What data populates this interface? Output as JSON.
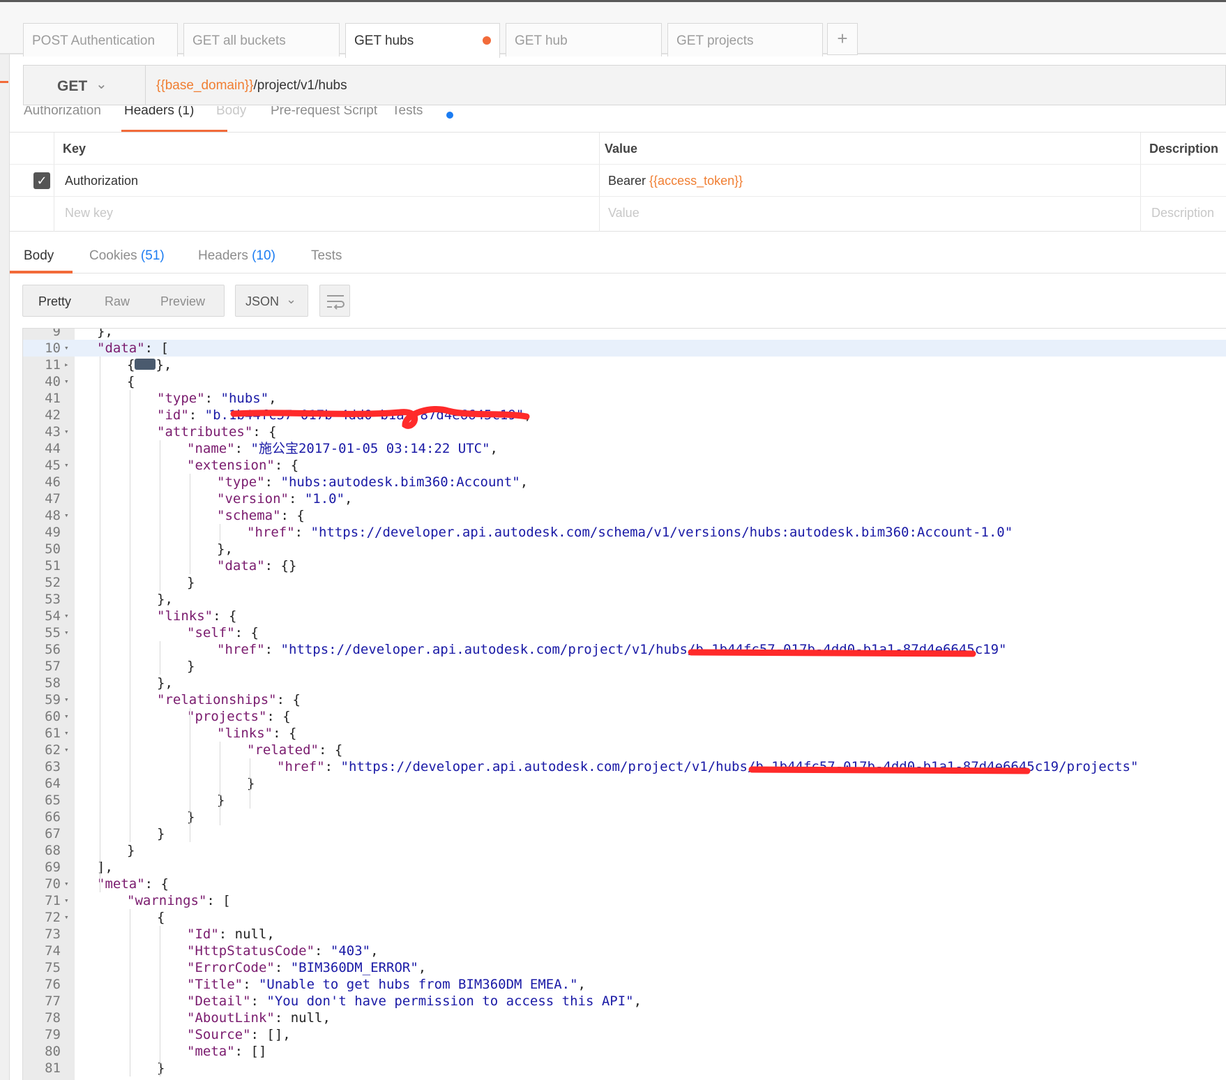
{
  "tabs": [
    {
      "label": "POST Authentication"
    },
    {
      "label": "GET all buckets"
    },
    {
      "label": "GET hubs"
    },
    {
      "label": "GET hub"
    },
    {
      "label": "GET projects"
    }
  ],
  "add_tab": "+",
  "request": {
    "method": "GET",
    "url_var": "{{base_domain}}",
    "url_path": "/project/v1/hubs"
  },
  "request_tabs": [
    "Authorization",
    "Headers (1)",
    "Body",
    "Pre-request Script",
    "Tests"
  ],
  "headers_table": {
    "columns": [
      "Key",
      "Value",
      "Description"
    ],
    "row": {
      "key": "Authorization",
      "value_prefix": "Bearer ",
      "value_var": "{{access_token}}"
    },
    "placeholder": {
      "key": "New key",
      "value": "Value",
      "description": "Description"
    }
  },
  "response_tabs": [
    {
      "label": "Body",
      "count": ""
    },
    {
      "label": "Cookies ",
      "count": "(51)"
    },
    {
      "label": "Headers ",
      "count": "(10)"
    },
    {
      "label": "Tests",
      "count": ""
    }
  ],
  "view_modes": [
    "Pretty",
    "Raw",
    "Preview"
  ],
  "format": "JSON",
  "icons": {
    "dropdown": "chevron-down-icon",
    "wrap": "wrap-lines-icon",
    "check": "check-icon"
  },
  "colors": {
    "accent": "#f26b3a",
    "variable": "#f07e32",
    "link_count": "#1b7cf2",
    "json_key": "#7a1b6e",
    "json_string": "#1a1aa6"
  },
  "code_lines": [
    {
      "n": "9",
      "fold": "",
      "indent": 1,
      "segs": [
        [
          "p",
          "},"
        ]
      ]
    },
    {
      "n": "10",
      "fold": "▾",
      "indent": 1,
      "segs": [
        [
          "k",
          "\"data\""
        ],
        [
          "p",
          ": ["
        ]
      ],
      "hl": true
    },
    {
      "n": "11",
      "fold": "▸",
      "indent": 2,
      "segs": [
        [
          "p",
          "{"
        ],
        [
          "c",
          ""
        ],
        [
          "p",
          "},"
        ]
      ]
    },
    {
      "n": "40",
      "fold": "▾",
      "indent": 2,
      "segs": [
        [
          "p",
          "{"
        ]
      ]
    },
    {
      "n": "41",
      "fold": "",
      "indent": 3,
      "segs": [
        [
          "k",
          "\"type\""
        ],
        [
          "p",
          ": "
        ],
        [
          "s",
          "\"hubs\""
        ],
        [
          "p",
          ","
        ]
      ]
    },
    {
      "n": "42",
      "fold": "",
      "indent": 3,
      "segs": [
        [
          "k",
          "\"id\""
        ],
        [
          "p",
          ": "
        ],
        [
          "s",
          "\"b.1b44fc57-017b-4dd0-b1a1-87d4e6645c19\""
        ],
        [
          "p",
          ","
        ]
      ]
    },
    {
      "n": "43",
      "fold": "▾",
      "indent": 3,
      "segs": [
        [
          "k",
          "\"attributes\""
        ],
        [
          "p",
          ": {"
        ]
      ]
    },
    {
      "n": "44",
      "fold": "",
      "indent": 4,
      "segs": [
        [
          "k",
          "\"name\""
        ],
        [
          "p",
          ": "
        ],
        [
          "s",
          "\"施公宝2017-01-05 03:14:22 UTC\""
        ],
        [
          "p",
          ","
        ]
      ]
    },
    {
      "n": "45",
      "fold": "▾",
      "indent": 4,
      "segs": [
        [
          "k",
          "\"extension\""
        ],
        [
          "p",
          ": {"
        ]
      ]
    },
    {
      "n": "46",
      "fold": "",
      "indent": 5,
      "segs": [
        [
          "k",
          "\"type\""
        ],
        [
          "p",
          ": "
        ],
        [
          "s",
          "\"hubs:autodesk.bim360:Account\""
        ],
        [
          "p",
          ","
        ]
      ]
    },
    {
      "n": "47",
      "fold": "",
      "indent": 5,
      "segs": [
        [
          "k",
          "\"version\""
        ],
        [
          "p",
          ": "
        ],
        [
          "s",
          "\"1.0\""
        ],
        [
          "p",
          ","
        ]
      ]
    },
    {
      "n": "48",
      "fold": "▾",
      "indent": 5,
      "segs": [
        [
          "k",
          "\"schema\""
        ],
        [
          "p",
          ": {"
        ]
      ]
    },
    {
      "n": "49",
      "fold": "",
      "indent": 6,
      "segs": [
        [
          "k",
          "\"href\""
        ],
        [
          "p",
          ": "
        ],
        [
          "s",
          "\"https://developer.api.autodesk.com/schema/v1/versions/hubs:autodesk.bim360:Account-1.0\""
        ]
      ]
    },
    {
      "n": "50",
      "fold": "",
      "indent": 5,
      "segs": [
        [
          "p",
          "},"
        ]
      ]
    },
    {
      "n": "51",
      "fold": "",
      "indent": 5,
      "segs": [
        [
          "k",
          "\"data\""
        ],
        [
          "p",
          ": {}"
        ]
      ]
    },
    {
      "n": "52",
      "fold": "",
      "indent": 4,
      "segs": [
        [
          "p",
          "}"
        ]
      ]
    },
    {
      "n": "53",
      "fold": "",
      "indent": 3,
      "segs": [
        [
          "p",
          "},"
        ]
      ]
    },
    {
      "n": "54",
      "fold": "▾",
      "indent": 3,
      "segs": [
        [
          "k",
          "\"links\""
        ],
        [
          "p",
          ": {"
        ]
      ]
    },
    {
      "n": "55",
      "fold": "▾",
      "indent": 4,
      "segs": [
        [
          "k",
          "\"self\""
        ],
        [
          "p",
          ": {"
        ]
      ]
    },
    {
      "n": "56",
      "fold": "",
      "indent": 5,
      "segs": [
        [
          "k",
          "\"href\""
        ],
        [
          "p",
          ": "
        ],
        [
          "s",
          "\"https://developer.api.autodesk.com/project/v1/hubs/b.1b44fc57-017b-4dd0-b1a1-87d4e6645c19\""
        ]
      ]
    },
    {
      "n": "57",
      "fold": "",
      "indent": 4,
      "segs": [
        [
          "p",
          "}"
        ]
      ]
    },
    {
      "n": "58",
      "fold": "",
      "indent": 3,
      "segs": [
        [
          "p",
          "},"
        ]
      ]
    },
    {
      "n": "59",
      "fold": "▾",
      "indent": 3,
      "segs": [
        [
          "k",
          "\"relationships\""
        ],
        [
          "p",
          ": {"
        ]
      ]
    },
    {
      "n": "60",
      "fold": "▾",
      "indent": 4,
      "segs": [
        [
          "k",
          "\"projects\""
        ],
        [
          "p",
          ": {"
        ]
      ]
    },
    {
      "n": "61",
      "fold": "▾",
      "indent": 5,
      "segs": [
        [
          "k",
          "\"links\""
        ],
        [
          "p",
          ": {"
        ]
      ]
    },
    {
      "n": "62",
      "fold": "▾",
      "indent": 6,
      "segs": [
        [
          "k",
          "\"related\""
        ],
        [
          "p",
          ": {"
        ]
      ]
    },
    {
      "n": "63",
      "fold": "",
      "indent": 7,
      "segs": [
        [
          "k",
          "\"href\""
        ],
        [
          "p",
          ": "
        ],
        [
          "s",
          "\"https://developer.api.autodesk.com/project/v1/hubs/b.1b44fc57-017b-4dd0-b1a1-87d4e6645c19/projects\""
        ]
      ]
    },
    {
      "n": "64",
      "fold": "",
      "indent": 6,
      "segs": [
        [
          "p",
          "}"
        ]
      ]
    },
    {
      "n": "65",
      "fold": "",
      "indent": 5,
      "segs": [
        [
          "p",
          "}"
        ]
      ]
    },
    {
      "n": "66",
      "fold": "",
      "indent": 4,
      "segs": [
        [
          "p",
          "}"
        ]
      ]
    },
    {
      "n": "67",
      "fold": "",
      "indent": 3,
      "segs": [
        [
          "p",
          "}"
        ]
      ]
    },
    {
      "n": "68",
      "fold": "",
      "indent": 2,
      "segs": [
        [
          "p",
          "}"
        ]
      ]
    },
    {
      "n": "69",
      "fold": "",
      "indent": 1,
      "segs": [
        [
          "p",
          "],"
        ]
      ]
    },
    {
      "n": "70",
      "fold": "▾",
      "indent": 1,
      "segs": [
        [
          "k",
          "\"meta\""
        ],
        [
          "p",
          ": {"
        ]
      ]
    },
    {
      "n": "71",
      "fold": "▾",
      "indent": 2,
      "segs": [
        [
          "k",
          "\"warnings\""
        ],
        [
          "p",
          ": ["
        ]
      ]
    },
    {
      "n": "72",
      "fold": "▾",
      "indent": 3,
      "segs": [
        [
          "p",
          "{"
        ]
      ]
    },
    {
      "n": "73",
      "fold": "",
      "indent": 4,
      "segs": [
        [
          "k",
          "\"Id\""
        ],
        [
          "p",
          ": null,"
        ]
      ]
    },
    {
      "n": "74",
      "fold": "",
      "indent": 4,
      "segs": [
        [
          "k",
          "\"HttpStatusCode\""
        ],
        [
          "p",
          ": "
        ],
        [
          "s",
          "\"403\""
        ],
        [
          "p",
          ","
        ]
      ]
    },
    {
      "n": "75",
      "fold": "",
      "indent": 4,
      "segs": [
        [
          "k",
          "\"ErrorCode\""
        ],
        [
          "p",
          ": "
        ],
        [
          "s",
          "\"BIM360DM_ERROR\""
        ],
        [
          "p",
          ","
        ]
      ]
    },
    {
      "n": "76",
      "fold": "",
      "indent": 4,
      "segs": [
        [
          "k",
          "\"Title\""
        ],
        [
          "p",
          ": "
        ],
        [
          "s",
          "\"Unable to get hubs from BIM360DM EMEA.\""
        ],
        [
          "p",
          ","
        ]
      ]
    },
    {
      "n": "77",
      "fold": "",
      "indent": 4,
      "segs": [
        [
          "k",
          "\"Detail\""
        ],
        [
          "p",
          ": "
        ],
        [
          "s",
          "\"You don't have permission to access this API\""
        ],
        [
          "p",
          ","
        ]
      ]
    },
    {
      "n": "78",
      "fold": "",
      "indent": 4,
      "segs": [
        [
          "k",
          "\"AboutLink\""
        ],
        [
          "p",
          ": null,"
        ]
      ]
    },
    {
      "n": "79",
      "fold": "",
      "indent": 4,
      "segs": [
        [
          "k",
          "\"Source\""
        ],
        [
          "p",
          ": [],"
        ]
      ]
    },
    {
      "n": "80",
      "fold": "",
      "indent": 4,
      "segs": [
        [
          "k",
          "\"meta\""
        ],
        [
          "p",
          ": []"
        ]
      ]
    },
    {
      "n": "81",
      "fold": "",
      "indent": 3,
      "segs": [
        [
          "p",
          "}"
        ]
      ]
    }
  ]
}
